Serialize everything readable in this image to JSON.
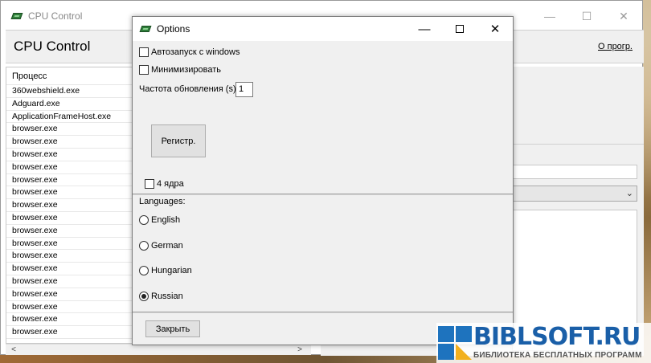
{
  "main_window": {
    "title": "CPU Control",
    "controls": {
      "minimize": "—",
      "maximize": "☐",
      "close": "✕"
    },
    "heading": "CPU Control",
    "about_link": "О прогр.",
    "process_column_header": "Процесс",
    "processes": [
      "360webshield.exe",
      "Adguard.exe",
      "ApplicationFrameHost.exe",
      "browser.exe",
      "browser.exe",
      "browser.exe",
      "browser.exe",
      "browser.exe",
      "browser.exe",
      "browser.exe",
      "browser.exe",
      "browser.exe",
      "browser.exe",
      "browser.exe",
      "browser.exe",
      "browser.exe",
      "browser.exe",
      "browser.exe",
      "browser.exe",
      "browser.exe"
    ],
    "scroll_left": "<",
    "scroll_right": ">",
    "combo_chevron": "⌄"
  },
  "options": {
    "title": "Options",
    "controls": {
      "minimize": "—",
      "close": "✕"
    },
    "autostart_label": "Автозапуск с windows",
    "autostart_checked": false,
    "minimize_label": "Минимизировать",
    "minimize_checked": false,
    "refresh_label": "Частота обновления (s):",
    "refresh_value": "1",
    "register_button": "Регистр.",
    "four_cores_label": "4 ядра",
    "four_cores_checked": false,
    "languages_label": "Languages:",
    "languages": [
      {
        "label": "English",
        "selected": false
      },
      {
        "label": "German",
        "selected": false
      },
      {
        "label": "Hungarian",
        "selected": false
      },
      {
        "label": "Russian",
        "selected": true
      }
    ],
    "close_button": "Закрыть"
  },
  "watermark": {
    "brand": "BIBLSOFT.RU",
    "subtitle": "БИБЛИОТЕКА БЕСПЛАТНЫХ ПРОГРАММ"
  },
  "colors": {
    "dialog_bg": "#f0f0f0",
    "button_bg": "#e1e1e1",
    "brand_blue": "#1a5fa8",
    "brand_yellow": "#f2b01e"
  }
}
